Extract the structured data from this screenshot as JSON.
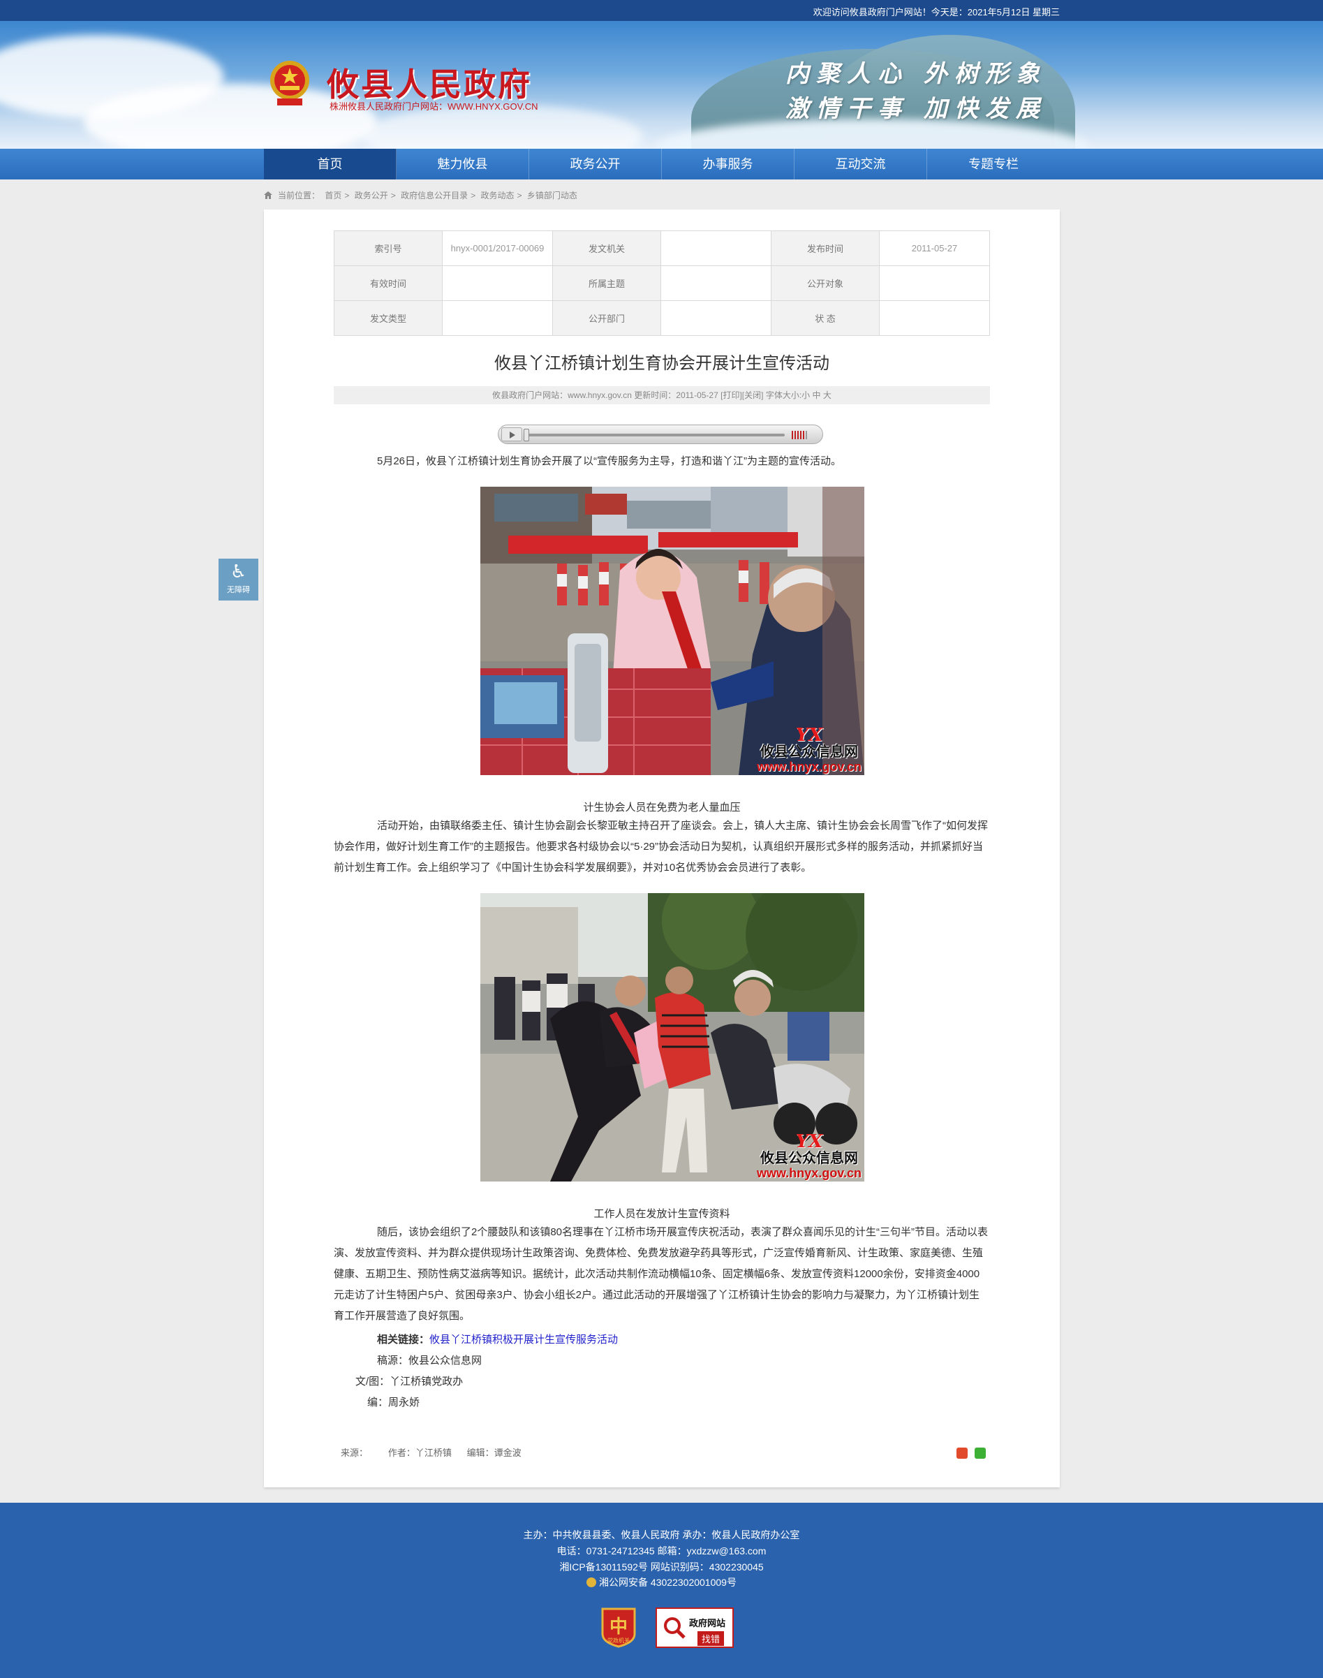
{
  "topbar": {
    "welcome": "欢迎访问攸县政府门户网站！今天是：2021年5月12日 星期三"
  },
  "header": {
    "title": "攸县人民政府",
    "subtitle": "株洲攸县人民政府门户网站：WWW.HNYX.GOV.CN",
    "slogan_line1": "内聚人心 外树形象",
    "slogan_line2": "激情干事 加快发展"
  },
  "nav": {
    "items": [
      {
        "label": "首页"
      },
      {
        "label": "魅力攸县"
      },
      {
        "label": "政务公开"
      },
      {
        "label": "办事服务"
      },
      {
        "label": "互动交流"
      },
      {
        "label": "专题专栏"
      }
    ],
    "active_index": 0
  },
  "breadcrumb": {
    "prefix": "当前位置：",
    "items": [
      "首页",
      "政务公开",
      "政府信息公开目录",
      "政务动态",
      "乡镇部门动态"
    ],
    "separator": ">"
  },
  "meta": {
    "rows": [
      [
        {
          "label": "索引号",
          "value": "hnyx-0001/2017-00069"
        },
        {
          "label": "发文机关",
          "value": ""
        },
        {
          "label": "发布时间",
          "value": "2011-05-27"
        }
      ],
      [
        {
          "label": "有效时间",
          "value": ""
        },
        {
          "label": "所属主题",
          "value": ""
        },
        {
          "label": "公开对象",
          "value": ""
        }
      ],
      [
        {
          "label": "发文类型",
          "value": ""
        },
        {
          "label": "公开部门",
          "value": ""
        },
        {
          "label": "状 态",
          "value": ""
        }
      ]
    ]
  },
  "article": {
    "title": "攸县丫江桥镇计划生育协会开展计生宣传活动",
    "info": {
      "site": "攸县政府门户网站：www.hnyx.gov.cn",
      "updated": "更新时间：2011-05-27",
      "print": "[打印]",
      "close": "[关闭]",
      "font_label": "字体大小:",
      "font_small": "小",
      "font_mid": "中",
      "font_big": "大"
    },
    "intro": "5月26日，攸县丫江桥镇计划生育协会开展了以“宣传服务为主导，打造和谐丫江”为主题的宣传活动。",
    "caption1": "计生协会人员在免费为老人量血压",
    "para1": "活动开始，由镇联络委主任、镇计生协会副会长黎亚敏主持召开了座谈会。会上，镇人大主席、镇计生协会会长周雪飞作了“如何发挥协会作用，做好计划生育工作”的主题报告。他要求各村级协会以“5·29”协会活动日为契机，认真组织开展形式多样的服务活动，并抓紧抓好当前计划生育工作。会上组织学习了《中国计生协会科学发展纲要》，并对10名优秀协会会员进行了表彰。",
    "caption2": "工作人员在发放计生宣传资料",
    "para2": "随后，该协会组织了2个腰鼓队和该镇80名理事在丫江桥市场开展宣传庆祝活动，表演了群众喜闻乐见的计生“三句半”节目。活动以表演、发放宣传资料、并为群众提供现场计生政策咨询、免费体检、免费发放避孕药具等形式，广泛宣传婚育新风、计生政策、家庭美德、生殖健康、五期卫生、预防性病艾滋病等知识。据统计，此次活动共制作流动横幅10条、固定横幅6条、发放宣传资料12000余份，安排资金4000元走访了计生特困户5户、贫困母亲3户、协会小组长2户。通过此活动的开展增强了丫江桥镇计生协会的影响力与凝聚力，为丫江桥镇计划生育工作开展营造了良好氛围。",
    "related_label": "相关链接：",
    "related_link": "攸县丫江桥镇积极开展计生宣传服务活动",
    "source_line": "稿源：攸县公众信息网",
    "author_line": "文/图：丫江桥镇党政办",
    "editor_line": "编：周永娇",
    "watermark": {
      "logo": "YX",
      "text1": "攸县公众信息网",
      "text2": "www.hnyx.gov.cn"
    },
    "footer_meta": {
      "source": "来源：",
      "author": "作者：丫江桥镇",
      "editor": "编辑：谭金波"
    }
  },
  "accessibility": {
    "label": "无障碍"
  },
  "footer": {
    "line1": "主办：中共攸县县委、攸县人民政府  承办：攸县人民政府办公室",
    "line2": "电话：0731-24712345  邮箱：yxdzzw@163.com",
    "line3": "湘ICP备13011592号    网站识别码：4302230045",
    "line4": "湘公网安备 43022302001009号",
    "badge1": "党政机关",
    "badge2_top": "政府网站",
    "badge2_bottom": "找错"
  }
}
